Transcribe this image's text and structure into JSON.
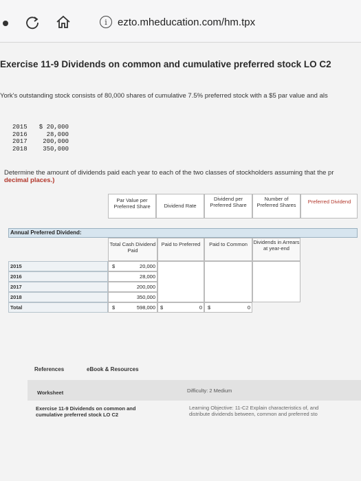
{
  "browser": {
    "url": "ezto.mheducation.com/hm.tpx"
  },
  "page": {
    "title": "Exercise 11-9 Dividends on common and cumulative preferred stock LO C2",
    "description": "York's outstanding stock consists of 80,000 shares of cumulative 7.5% preferred stock with a $5 par value and als",
    "preferred_table": [
      {
        "year": "2015",
        "amount": "$ 20,000"
      },
      {
        "year": "2016",
        "amount": "28,000"
      },
      {
        "year": "2017",
        "amount": "200,000"
      },
      {
        "year": "2018",
        "amount": "350,000"
      }
    ],
    "instruction_line1": "Determine the amount of dividends paid each year to each of the two classes of stockholders assuming that the pr",
    "instruction_line2": "decimal places.)"
  },
  "table": {
    "headers_top": [
      "Par Value per Preferred Share",
      "Dividend Rate",
      "Dividend per Preferred Share",
      "Number of Preferred Shares",
      "Preferred Dividend"
    ],
    "annual_label": "Annual Preferred Dividend:",
    "headers_mid": [
      "Total Cash Dividend Paid",
      "Paid to Preferred",
      "Paid to Common",
      "Dividends in Arrears at year-end"
    ],
    "rows": [
      {
        "year": "2015",
        "total": "20,000",
        "dollar": "$"
      },
      {
        "year": "2016",
        "total": "28,000"
      },
      {
        "year": "2017",
        "total": "200,000"
      },
      {
        "year": "2018",
        "total": "350,000"
      },
      {
        "year": "Total",
        "total": "598,000",
        "dollar": "$",
        "preferred_dollar": "$",
        "preferred": "0",
        "common_dollar": "$",
        "common": "0"
      }
    ]
  },
  "footer": {
    "references": "References",
    "ebook": "eBook & Resources",
    "worksheet": "Worksheet",
    "difficulty": "Difficulty: 2 Medium",
    "exercise_line1": "Exercise 11-9 Dividends on common and",
    "exercise_line2": "cumulative preferred stock LO C2",
    "lo_line1": "Learning Objective: 11-C2 Explain characteristics of, and",
    "lo_line2": "distribute dividends between, common and preferred sto"
  }
}
